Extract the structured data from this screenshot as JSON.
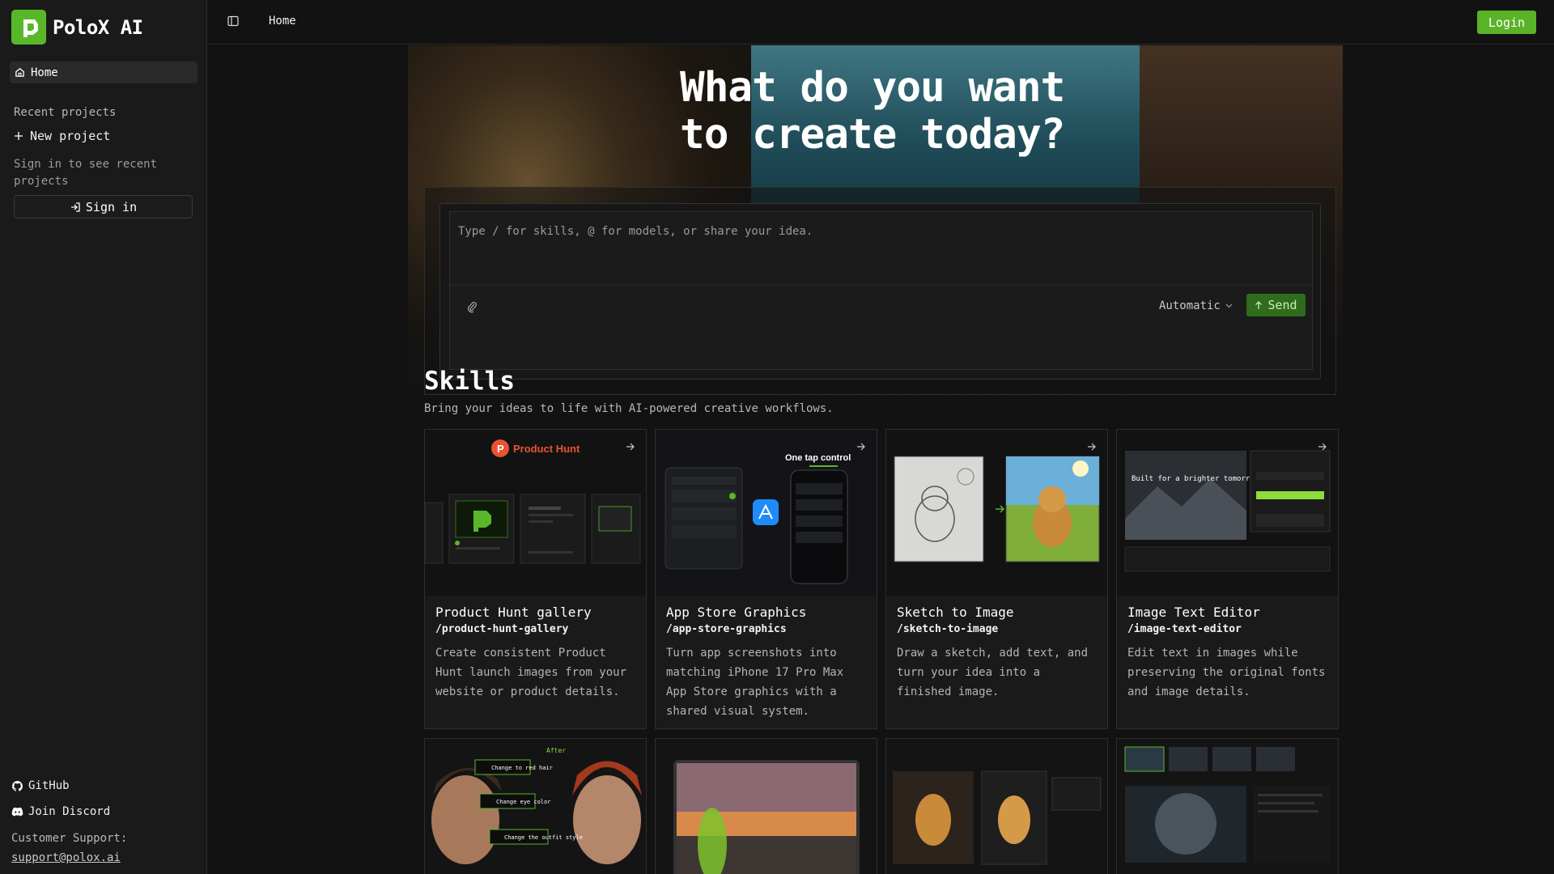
{
  "app": {
    "name": "PoloX AI"
  },
  "sidebar": {
    "home_label": "Home",
    "recent_label": "Recent projects",
    "new_project_label": "New project",
    "signin_hint": "Sign in to see recent projects",
    "signin_label": "Sign in",
    "github_label": "GitHub",
    "discord_label": "Join Discord",
    "support_label": "Customer Support:",
    "support_email": "support@polox.ai"
  },
  "topbar": {
    "breadcrumb": "Home",
    "login_label": "Login"
  },
  "hero": {
    "title": "What do you want to create today?"
  },
  "composer": {
    "placeholder": "Type / for skills, @ for models, or share your idea.",
    "model_label": "Automatic",
    "send_label": "Send"
  },
  "skills": {
    "title": "Skills",
    "subtitle": "Bring your ideas to life with AI-powered creative workflows.",
    "cards": [
      {
        "title": "Product Hunt gallery",
        "slug": "/product-hunt-gallery",
        "desc": "Create consistent Product Hunt launch images from your website or product details.",
        "thumb_text": "Product Hunt"
      },
      {
        "title": "App Store Graphics",
        "slug": "/app-store-graphics",
        "desc": "Turn app screenshots into matching iPhone 17 Pro Max App Store graphics with a shared visual system.",
        "thumb_text": "One tap control"
      },
      {
        "title": "Sketch to Image",
        "slug": "/sketch-to-image",
        "desc": "Draw a sketch, add text, and turn your idea into a finished image."
      },
      {
        "title": "Image Text Editor",
        "slug": "/image-text-editor",
        "desc": "Edit text in images while preserving the original fonts and image details.",
        "thumb_text": "Built for a brighter tomorrow"
      }
    ],
    "row2_labels": [
      "After",
      "Change to red hair",
      "Change eye color",
      "Change the outfit style"
    ]
  },
  "colors": {
    "accent": "#5ab226",
    "bg": "#121212",
    "sidebar": "#1a1a1a"
  }
}
